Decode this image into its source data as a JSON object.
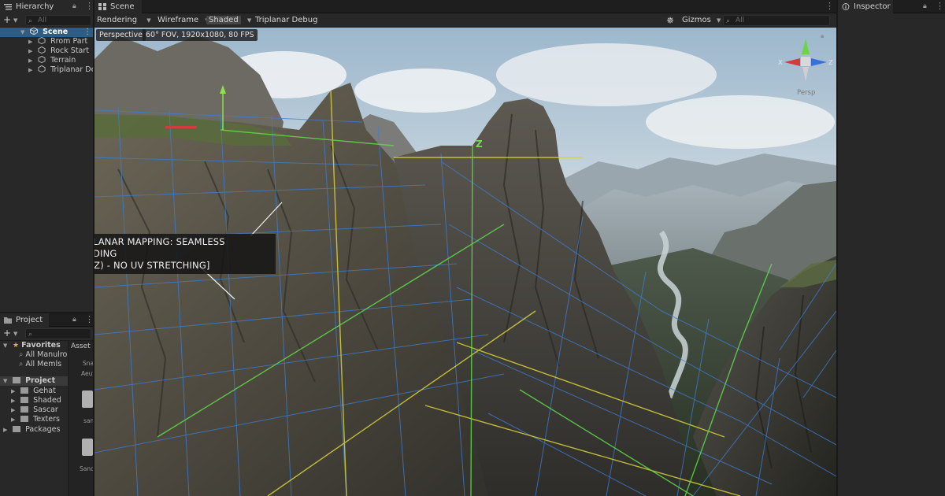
{
  "hierarchy": {
    "tab_label": "Hierarchy",
    "search_placeholder": "All",
    "scene_name": "Scene",
    "items": [
      {
        "label": "Rrom Part"
      },
      {
        "label": "Rock Start"
      },
      {
        "label": "Terrain"
      },
      {
        "label": "Triplanar Deb"
      }
    ]
  },
  "project": {
    "tab_label": "Project",
    "favorites_label": "Favorites",
    "favorites": [
      {
        "label": "All Manulro"
      },
      {
        "label": "All Memls"
      }
    ],
    "root_label": "Project",
    "folders": [
      {
        "label": "Gehat"
      },
      {
        "label": "Shaded"
      },
      {
        "label": "Sascar"
      },
      {
        "label": "Texters"
      }
    ],
    "packages_label": "Packages",
    "assets_header": "Asset",
    "asset_labels": [
      "Sna",
      "Aeut",
      "sam",
      "Sand"
    ]
  },
  "scene": {
    "tab_label": "Scene",
    "toolbar": {
      "rendering": "Rendering",
      "wireframe": "Wireframe",
      "shaded": "Shaded",
      "debug": "Triplanar Debug",
      "gizmos": "Gizmos",
      "search_placeholder": "All"
    },
    "perspective_label": "Perspective",
    "camera_info": "60° FOV, 1920x1080, 80 FPS",
    "axis_z_label": "Z",
    "gizmo_labels": {
      "x": "X",
      "z": "Z",
      "persp": "Persp"
    },
    "callout_line1": "[TRIPLANAR MAPPING: SEAMLESS BLENDING",
    "callout_line2": "(X/Y/Z) - NO UV STRETCHING]"
  },
  "inspector": {
    "tab_label": "Inspector"
  },
  "colors": {
    "panel_bg": "#282828",
    "tab_bg": "#1e1e1e",
    "selection": "#2c5d87",
    "grid_blue": "#3d7fd6",
    "grid_yellow": "#d8d23a",
    "grid_green": "#5fd94a",
    "gizmo_x": "#d23c3c",
    "gizmo_y": "#6ed24a",
    "gizmo_z": "#3a6fd8"
  },
  "icons": {
    "menu": "kebab-icon",
    "lock": "lock-icon",
    "search": "search-icon",
    "add": "plus-icon",
    "folder": "folder-icon",
    "star": "star-icon",
    "cube": "gameobject-icon",
    "unity": "unity-scene-icon",
    "light": "light-toggle-icon"
  }
}
